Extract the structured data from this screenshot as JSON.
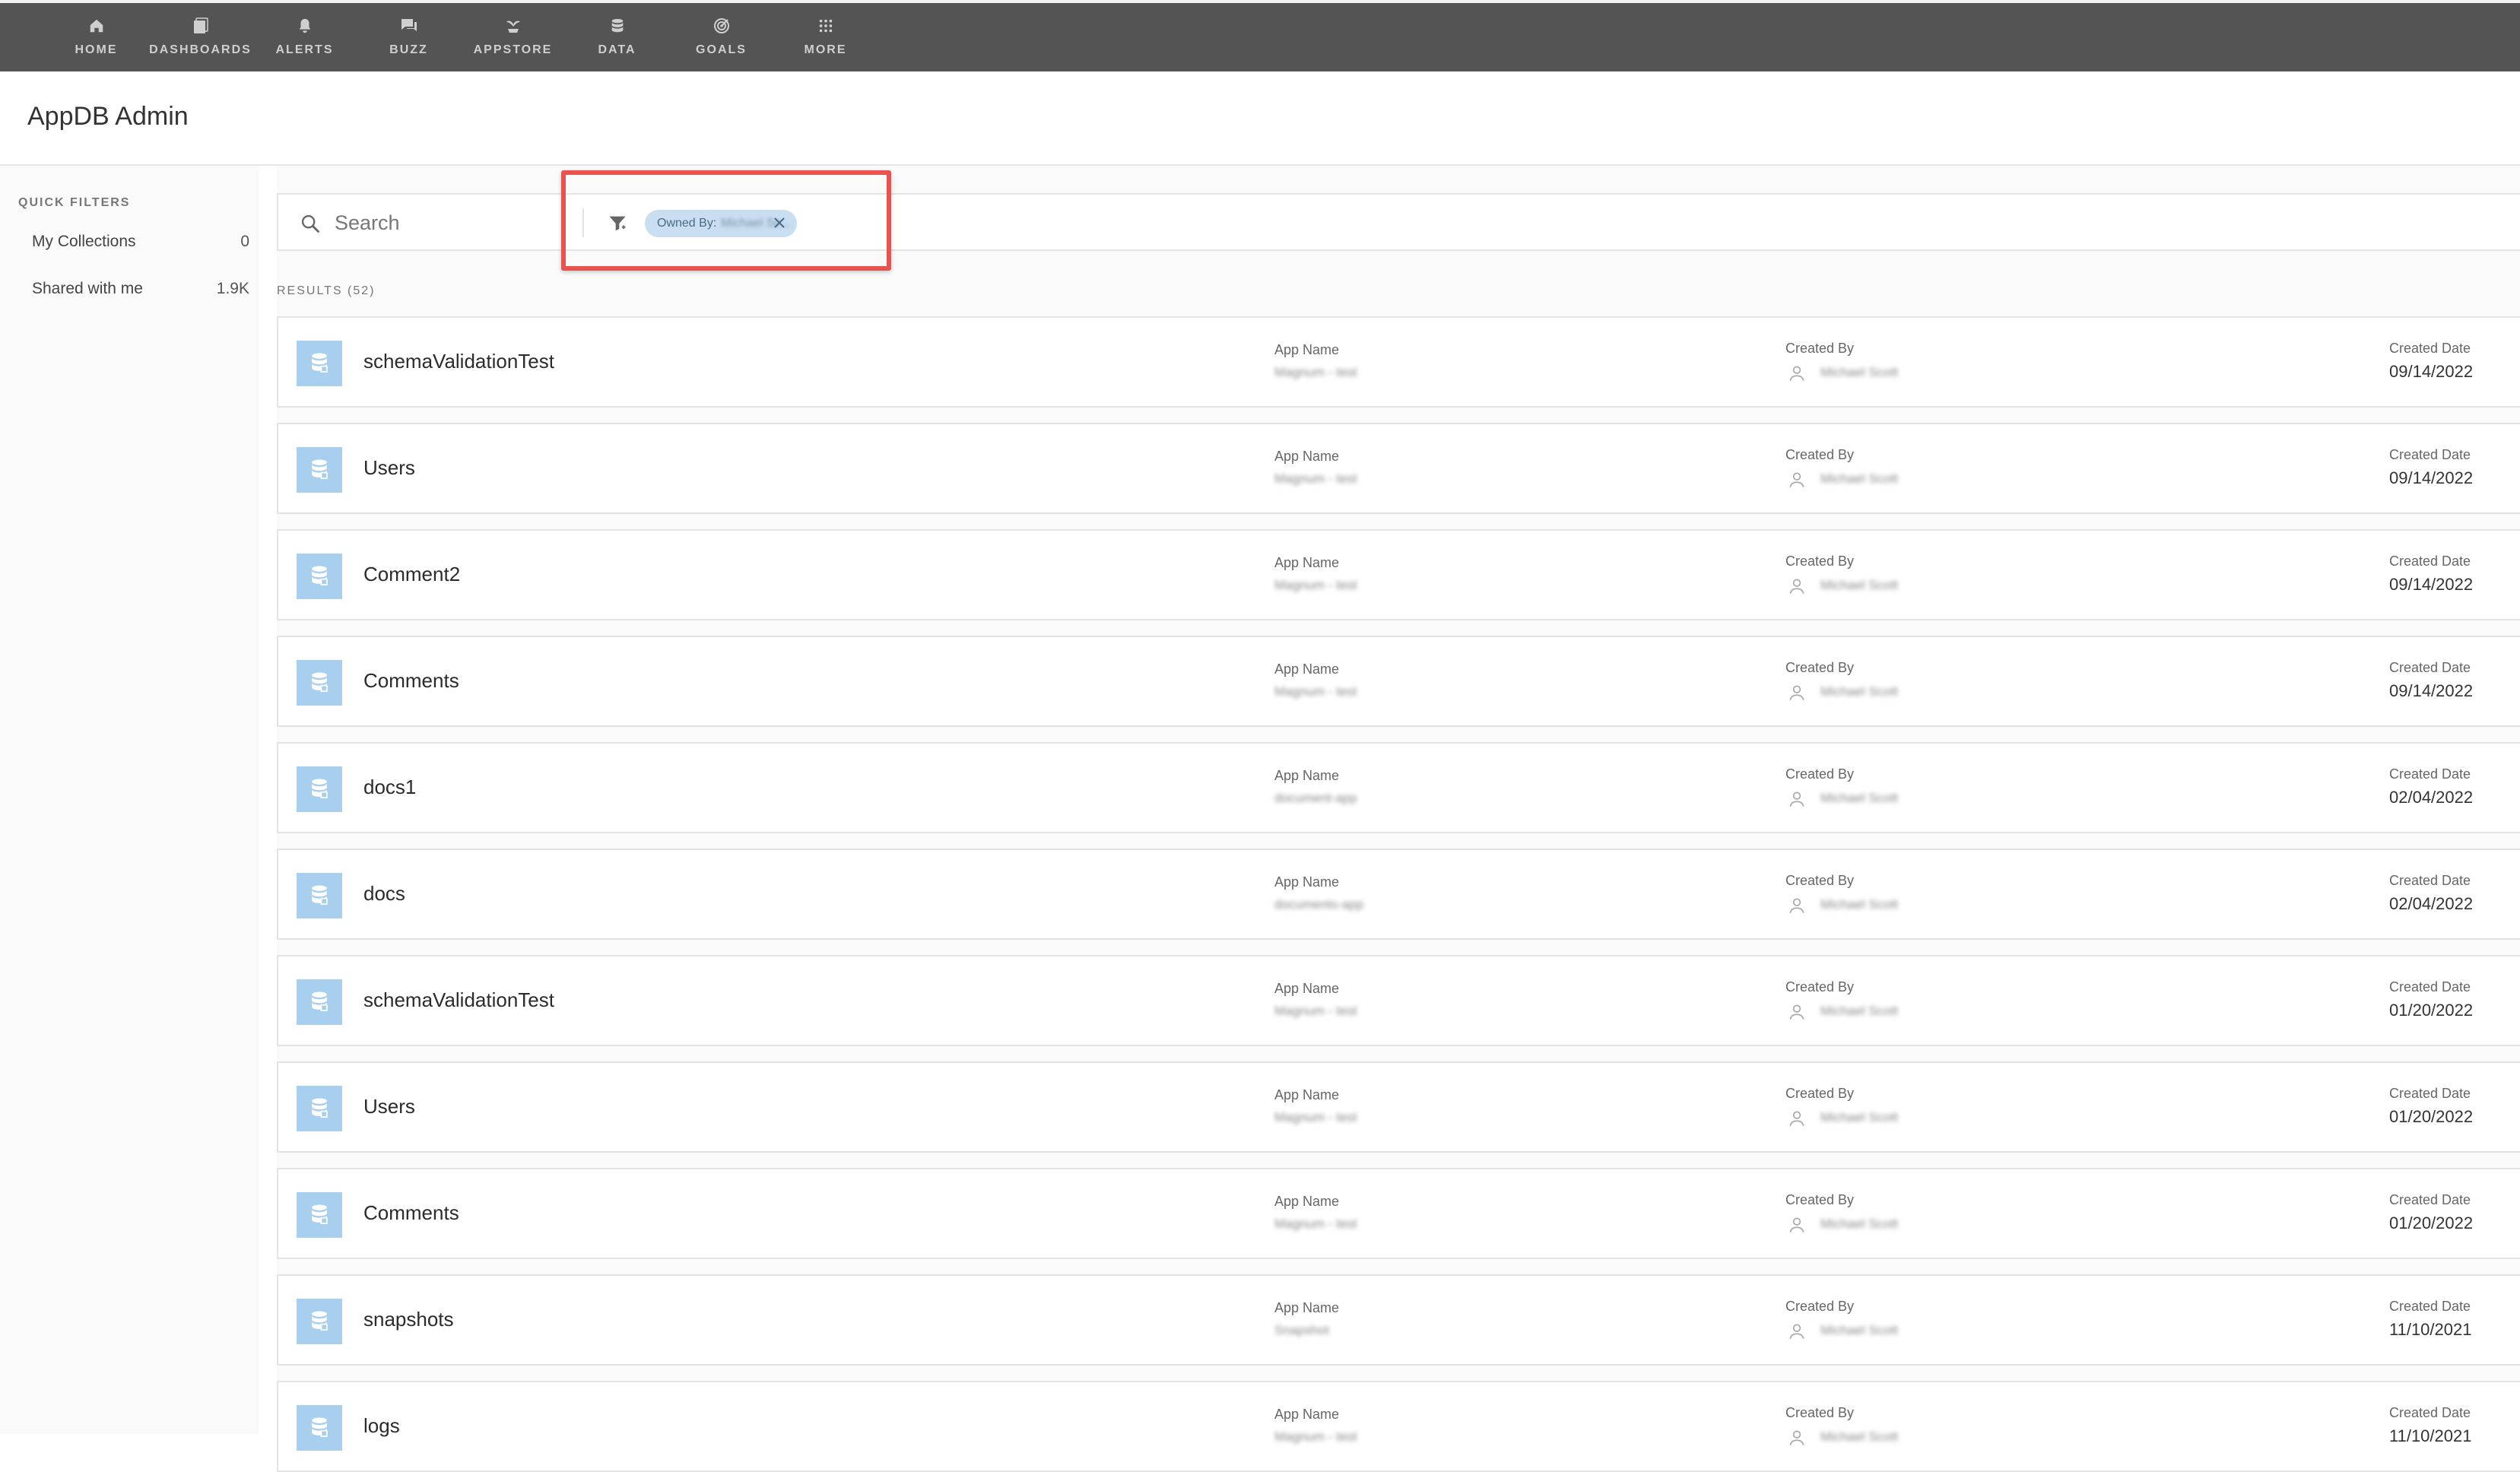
{
  "nav": {
    "items": [
      {
        "label": "HOME",
        "icon": "home-icon"
      },
      {
        "label": "DASHBOARDS",
        "icon": "dashboards-icon"
      },
      {
        "label": "ALERTS",
        "icon": "bell-icon"
      },
      {
        "label": "BUZZ",
        "icon": "chat-icon"
      },
      {
        "label": "APPSTORE",
        "icon": "appstore-icon"
      },
      {
        "label": "DATA",
        "icon": "database-icon"
      },
      {
        "label": "GOALS",
        "icon": "target-icon"
      },
      {
        "label": "MORE",
        "icon": "grid-icon"
      }
    ]
  },
  "header": {
    "title": "AppDB Admin"
  },
  "sidebar": {
    "heading": "QUICK FILTERS",
    "items": [
      {
        "label": "My Collections",
        "count": "0"
      },
      {
        "label": "Shared with me",
        "count": "1.9K"
      }
    ]
  },
  "search": {
    "placeholder": "Search"
  },
  "filter_chip": {
    "label": "Owned By:",
    "value": "Michael Sc..."
  },
  "results": {
    "label": "RESULTS (52)",
    "columns": {
      "app": "App Name",
      "created_by": "Created By",
      "date": "Created Date"
    },
    "rows": [
      {
        "name": "schemaValidationTest",
        "app": "Magnum - test",
        "creator": "Michael Scott",
        "date": "09/14/2022"
      },
      {
        "name": "Users",
        "app": "Magnum - test",
        "creator": "Michael Scott",
        "date": "09/14/2022"
      },
      {
        "name": "Comment2",
        "app": "Magnum - test",
        "creator": "Michael Scott",
        "date": "09/14/2022"
      },
      {
        "name": "Comments",
        "app": "Magnum - test",
        "creator": "Michael Scott",
        "date": "09/14/2022"
      },
      {
        "name": "docs1",
        "app": "document-app",
        "creator": "Michael Scott",
        "date": "02/04/2022"
      },
      {
        "name": "docs",
        "app": "documents-app",
        "creator": "Michael Scott",
        "date": "02/04/2022"
      },
      {
        "name": "schemaValidationTest",
        "app": "Magnum - test",
        "creator": "Michael Scott",
        "date": "01/20/2022"
      },
      {
        "name": "Users",
        "app": "Magnum - test",
        "creator": "Michael Scott",
        "date": "01/20/2022"
      },
      {
        "name": "Comments",
        "app": "Magnum - test",
        "creator": "Michael Scott",
        "date": "01/20/2022"
      },
      {
        "name": "snapshots",
        "app": "Snapshot",
        "creator": "Michael Scott",
        "date": "11/10/2021"
      },
      {
        "name": "logs",
        "app": "Magnum - test",
        "creator": "Michael Scott",
        "date": "11/10/2021"
      }
    ]
  },
  "colors": {
    "nav_bg": "#545454",
    "icon_bg": "#a9cfee",
    "chip_bg": "#c9def0",
    "highlight": "#e8524f"
  }
}
